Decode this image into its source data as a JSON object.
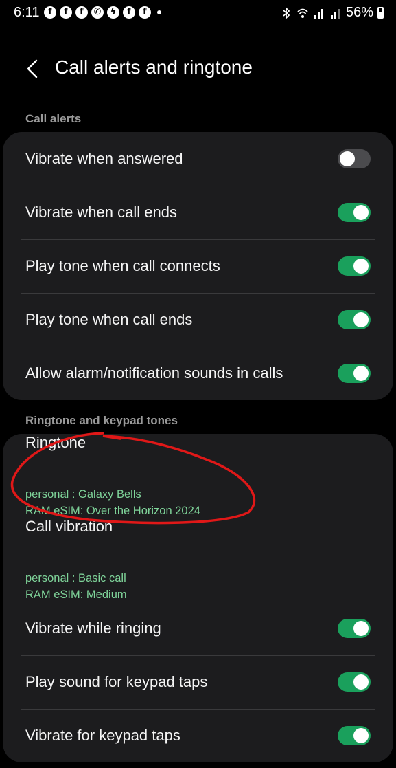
{
  "status_bar": {
    "time": "6:11",
    "battery": "56%",
    "notification_icons": [
      "facebook-icon",
      "facebook-icon",
      "facebook-icon",
      "whatsapp-icon",
      "messenger-icon",
      "facebook-icon",
      "facebook-icon",
      "dot-icon"
    ]
  },
  "header": {
    "title": "Call alerts and ringtone"
  },
  "sections": {
    "call_alerts": {
      "label": "Call alerts",
      "items": [
        {
          "label": "Vibrate when answered",
          "enabled": false
        },
        {
          "label": "Vibrate when call ends",
          "enabled": true
        },
        {
          "label": "Play tone when call connects",
          "enabled": true
        },
        {
          "label": "Play tone when call ends",
          "enabled": true
        },
        {
          "label": "Allow alarm/notification sounds in calls",
          "enabled": true
        }
      ]
    },
    "ringtone": {
      "label": "Ringtone and keypad tones",
      "ringtone": {
        "label": "Ringtone",
        "line1": "personal : Galaxy Bells",
        "line2": "RAM eSIM: Over the Horizon 2024"
      },
      "call_vibration": {
        "label": "Call vibration",
        "line1": "personal : Basic call",
        "line2": "RAM eSIM: Medium"
      },
      "items": [
        {
          "label": "Vibrate while ringing",
          "enabled": true
        },
        {
          "label": "Play sound for keypad taps",
          "enabled": true
        },
        {
          "label": "Vibrate for keypad taps",
          "enabled": true
        }
      ]
    }
  },
  "colors": {
    "accent": "#1aa05c",
    "subtext": "#7fd49a",
    "card": "#1c1c1e",
    "annotation": "#e01818"
  }
}
